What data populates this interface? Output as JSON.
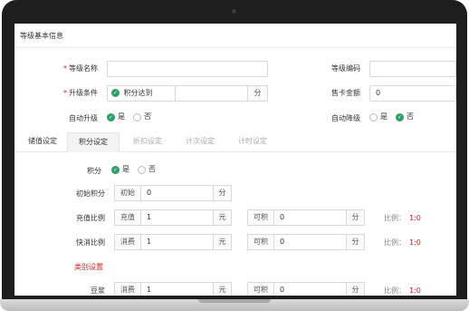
{
  "section_title": "等级基本信息",
  "fields": {
    "level_name_label": "等级名称",
    "level_code_label": "等级编码",
    "upgrade_condition_label": "升级条件",
    "upgrade_condition_option": "积分达到",
    "upgrade_unit": "分",
    "card_price_label": "售卡金额",
    "card_price_value": "0",
    "auto_upgrade_label": "自动升级",
    "auto_downgrade_label": "自动降级",
    "yes": "是",
    "no": "否"
  },
  "tabs": [
    {
      "label": "储值设定"
    },
    {
      "label": "积分设定"
    },
    {
      "label": "折扣设定"
    },
    {
      "label": "计次设定"
    },
    {
      "label": "计时设定"
    }
  ],
  "points": {
    "points_label": "积分",
    "initial_label": "初始积分",
    "initial_prefix": "初始",
    "initial_value": "0",
    "unit_fen": "分",
    "unit_yuan": "元",
    "rows": [
      {
        "label": "充值比例",
        "prefix": "充值",
        "value": "1",
        "earn_prefix": "可积",
        "earn_value": "0",
        "ratio_label": "比例：",
        "ratio_value": "1:0"
      },
      {
        "label": "快消比例",
        "prefix": "消费",
        "value": "1",
        "earn_prefix": "可积",
        "earn_value": "0",
        "ratio_label": "比例：",
        "ratio_value": "1:0"
      }
    ],
    "category_title": "类别设置",
    "category_rows": [
      {
        "label": "豆浆",
        "prefix": "消费",
        "value": "1",
        "earn_prefix": "可积",
        "earn_value": "0",
        "ratio_label": "比例：",
        "ratio_value": "1:0"
      }
    ]
  },
  "colors": {
    "accent_green": "#2e9e6a",
    "required_red": "#e02020"
  }
}
